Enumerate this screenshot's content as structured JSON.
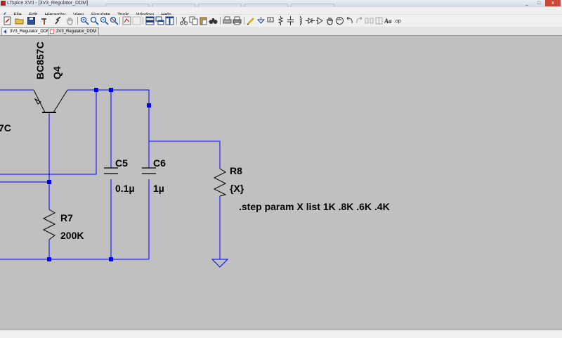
{
  "window": {
    "title": "LTspice XVII - [3V3_Regulator_DDM]",
    "minimize": "_",
    "maximize": "□",
    "close": "x"
  },
  "menu": {
    "items": [
      "File",
      "Edit",
      "Hierarchy",
      "View",
      "Simulate",
      "Tools",
      "Window",
      "Help"
    ]
  },
  "mdi_controls": "- ▫ ×",
  "tabs": [
    {
      "label": "3V3_Regulator_DDM",
      "icon": "schematic-icon"
    },
    {
      "label": "3V3_Regulator_DDM",
      "icon": "waveform-icon"
    }
  ],
  "schematic": {
    "transistor": {
      "model": "BC857C",
      "ref": "Q4"
    },
    "partial_label": "7C",
    "components": [
      {
        "ref": "C5",
        "value": "0.1µ"
      },
      {
        "ref": "C6",
        "value": "1µ"
      },
      {
        "ref": "R7",
        "value": "200K"
      },
      {
        "ref": "R8",
        "value": "{X}"
      }
    ],
    "directive": ".step param X list 1K .8K .6K .4K"
  },
  "colors": {
    "wire": "#0000ff",
    "junction": "#0000ff",
    "component": "#000000",
    "canvas": "#c0c0c0"
  }
}
